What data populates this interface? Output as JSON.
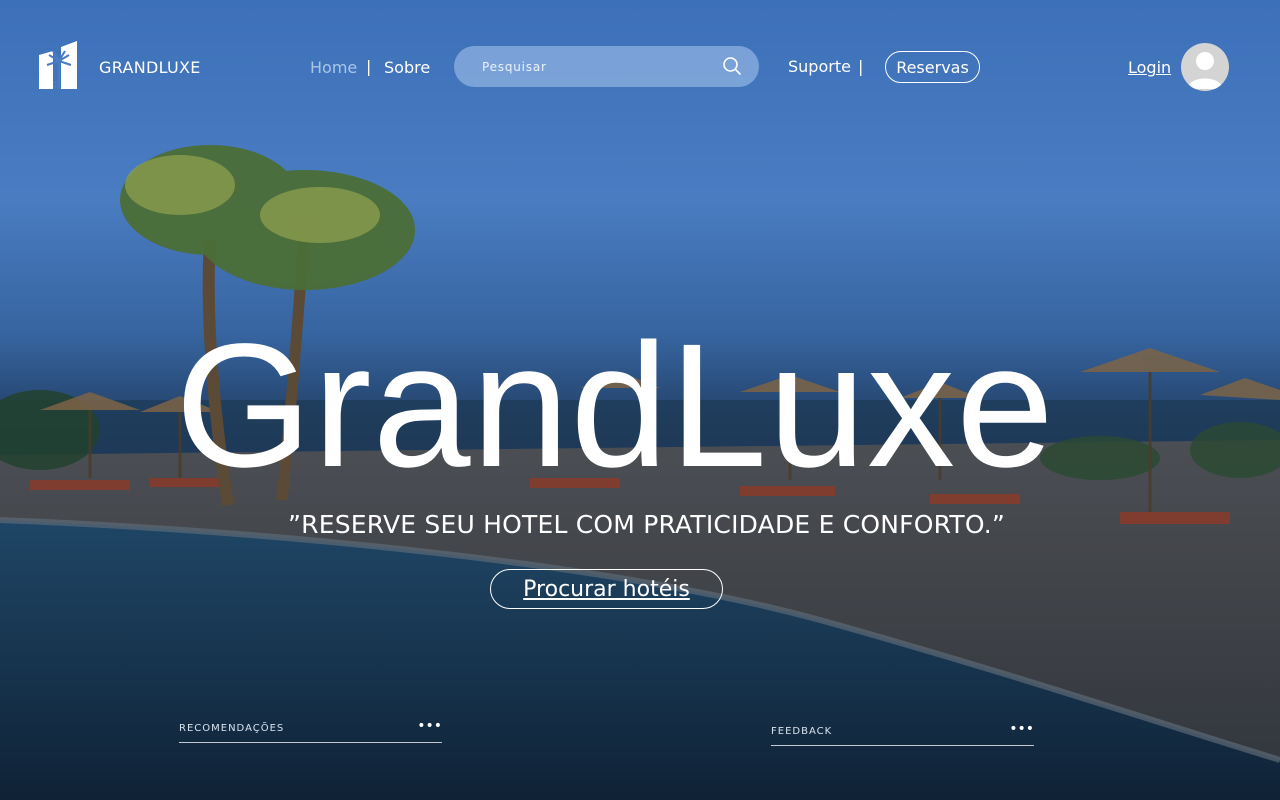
{
  "header": {
    "brand": "GRANDLUXE",
    "nav": {
      "home": "Home",
      "sobre": "Sobre",
      "suporte": "Suporte",
      "separator": "|"
    },
    "search": {
      "placeholder": "Pesquisar",
      "value": "",
      "icon": "search-icon"
    },
    "reservas_label": "Reservas",
    "login_label": "Login",
    "avatar_icon": "user-avatar-icon"
  },
  "hero": {
    "title": "GrandLuxe",
    "subtitle": "”RESERVE SEU HOTEL COM PRATICIDADE E CONFORTO.”",
    "cta_label": "Procurar hotéis"
  },
  "panels": {
    "recomendacoes": {
      "label": "RECOMENDAÇÕES",
      "more": "•••"
    },
    "feedback": {
      "label": "FEEDBACK",
      "more": "•••"
    }
  },
  "colors": {
    "sky": "#3c70b8",
    "nav_active": "#aac6e6",
    "search_bg": "#8ab0e0",
    "text": "#ffffff"
  }
}
